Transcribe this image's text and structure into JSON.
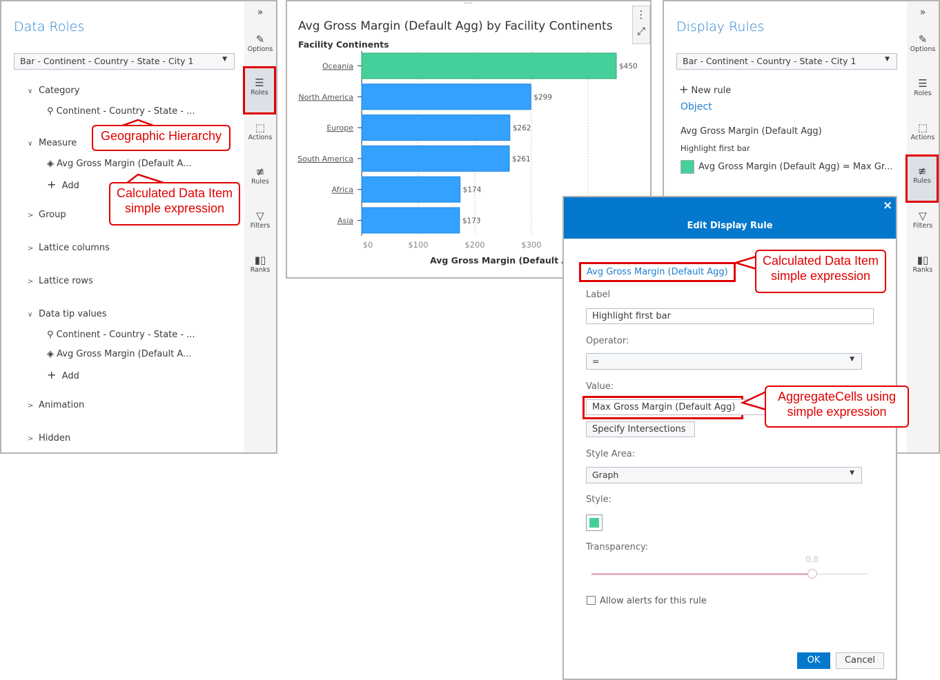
{
  "data_roles": {
    "title": "Data Roles",
    "object_select": "Bar - Continent - Country - State - City 1",
    "category_label": "Category",
    "category_item": "Continent - Country - State - ...",
    "measure_label": "Measure",
    "measure_item": "Avg Gross Margin (Default A...",
    "add": "Add",
    "group": "Group",
    "lattice_columns": "Lattice columns",
    "lattice_rows": "Lattice rows",
    "data_tip_values": "Data tip values",
    "tip_item1": "Continent - Country - State - ...",
    "tip_item2": "Avg Gross Margin (Default A...",
    "tip_add": "Add",
    "animation": "Animation",
    "hidden": "Hidden"
  },
  "rail": {
    "collapse": "»",
    "options": "Options",
    "roles": "Roles",
    "actions": "Actions",
    "rules": "Rules",
    "filters": "Filters",
    "ranks": "Ranks"
  },
  "callouts": {
    "geo": "Geographic Hierarchy",
    "calc1": "Calculated Data Item",
    "calc2": "simple expression",
    "agg1": "AggregateCells using",
    "agg2": "simple expression"
  },
  "chart_data": {
    "type": "bar",
    "title": "Avg Gross Margin (Default Agg) by Facility Continents",
    "ylabel": "Facility Continents",
    "xlabel": "Avg Gross Margin (Default Agg)",
    "categories": [
      "Oceania",
      "North America",
      "Europe",
      "South America",
      "Africa",
      "Asia"
    ],
    "values": [
      450,
      299,
      262,
      261,
      174,
      173
    ],
    "data_labels": [
      "$450",
      "$299",
      "$262",
      "$261",
      "$174",
      "$173"
    ],
    "xticks": [
      "$0",
      "$100",
      "$200",
      "$300"
    ],
    "xlim": [
      0,
      460
    ],
    "colors": [
      "#45d09b",
      "#33a1fd",
      "#33a1fd",
      "#33a1fd",
      "#33a1fd",
      "#33a1fd"
    ]
  },
  "display_rules": {
    "title": "Display Rules",
    "object_select": "Bar - Continent - Country - State - City 1",
    "new_rule": "New rule",
    "object": "Object",
    "measure": "Avg Gross Margin (Default Agg)",
    "rule_label": "Highlight first bar",
    "rule": "Avg Gross Margin (Default Agg) = Max Gr..."
  },
  "dialog": {
    "title": "Edit Display Rule",
    "close": "×",
    "measure": "Avg Gross Margin (Default Agg)",
    "label_label": "Label",
    "label_value": "Highlight first bar",
    "operator_label": "Operator:",
    "operator_value": "=",
    "value_label": "Value:",
    "value_value": "Max Gross Margin (Default Agg)",
    "specify": "Specify Intersections",
    "style_area_label": "Style Area:",
    "style_area_value": "Graph",
    "style_label": "Style:",
    "style_color": "#45d09b",
    "transparency_label": "Transparency:",
    "transparency_value": "0.8",
    "transparency": 0.8,
    "allow_alerts": "Allow alerts for this rule",
    "ok": "OK",
    "cancel": "Cancel"
  }
}
